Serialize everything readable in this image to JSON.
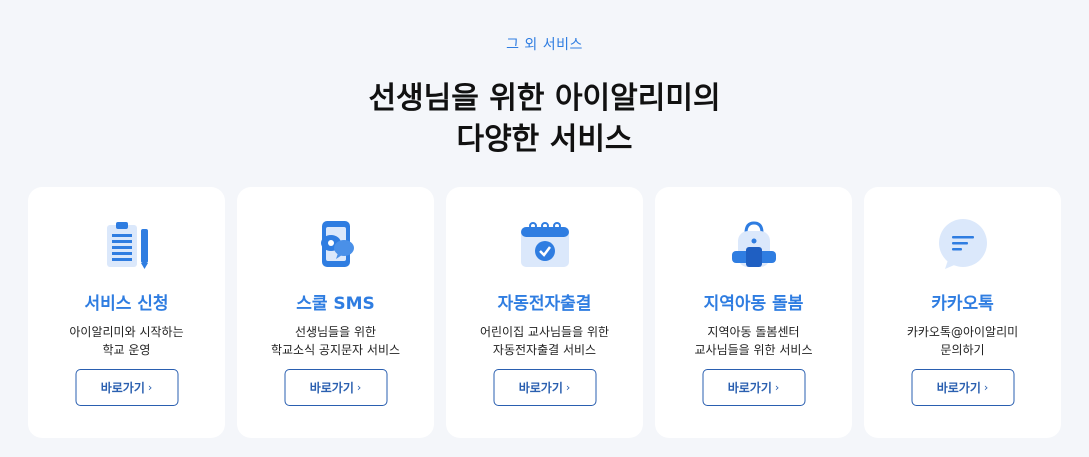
{
  "section": {
    "eyebrow": "그 외 서비스",
    "title_line1": "선생님을 위한 아이알리미의",
    "title_line2": "다양한 서비스"
  },
  "cards": [
    {
      "icon": "clipboard-pencil-icon",
      "title": "서비스 신청",
      "desc_line1": "아이알리미와 시작하는",
      "desc_line2": "학교 운영",
      "button": "바로가기",
      "chevron": "›"
    },
    {
      "icon": "phone-chat-icon",
      "title": "스쿨 SMS",
      "desc_line1": "선생님들을 위한",
      "desc_line2": "학교소식 공지문자 서비스",
      "button": "바로가기",
      "chevron": "›"
    },
    {
      "icon": "calendar-check-icon",
      "title": "자동전자출결",
      "desc_line1": "어린이집 교사님들을 위한",
      "desc_line2": "자동전자출결 서비스",
      "button": "바로가기",
      "chevron": "›"
    },
    {
      "icon": "backpack-icon",
      "title": "지역아동 돌봄",
      "desc_line1": "지역아동 돌봄센터",
      "desc_line2": "교사님들을 위한 서비스",
      "button": "바로가기",
      "chevron": "›"
    },
    {
      "icon": "chat-bubble-icon",
      "title": "카카오톡",
      "desc_line1": "카카오톡@아이알리미",
      "desc_line2": "문의하기",
      "button": "바로가기",
      "chevron": "›"
    }
  ],
  "colors": {
    "accent": "#2f7de1",
    "button_border": "#2a5fb0",
    "background": "#f4f6fa"
  }
}
